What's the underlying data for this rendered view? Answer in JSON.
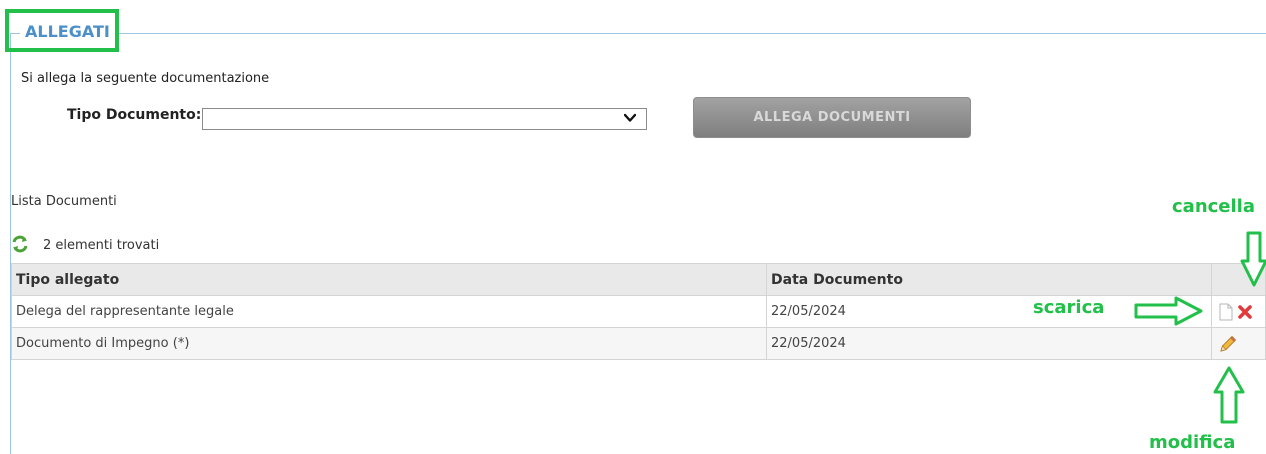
{
  "section": {
    "title": "ALLEGATI"
  },
  "form": {
    "intro": "Si allega la seguente documentazione",
    "tipo_documento_label": "Tipo Documento:",
    "tipo_documento_value": "",
    "allega_button": "ALLEGA DOCUMENTI"
  },
  "list": {
    "title": "Lista Documenti",
    "count_text": "2 elementi trovati",
    "columns": [
      "Tipo allegato",
      "Data Documento",
      ""
    ],
    "rows": [
      {
        "tipo": "Delega del rappresentante legale",
        "data": "22/05/2024",
        "actions": [
          "document-icon",
          "delete-icon"
        ]
      },
      {
        "tipo": "Documento di Impegno (*)",
        "data": "22/05/2024",
        "actions": [
          "edit-pencil-icon"
        ]
      }
    ]
  },
  "annotations": {
    "cancella": "cancella",
    "scarica": "scarica",
    "modifica": "modifica"
  },
  "colors": {
    "accent_blue": "#4c8fc9",
    "annotation_green": "#22c04a",
    "delete_red": "#e23b3b"
  }
}
